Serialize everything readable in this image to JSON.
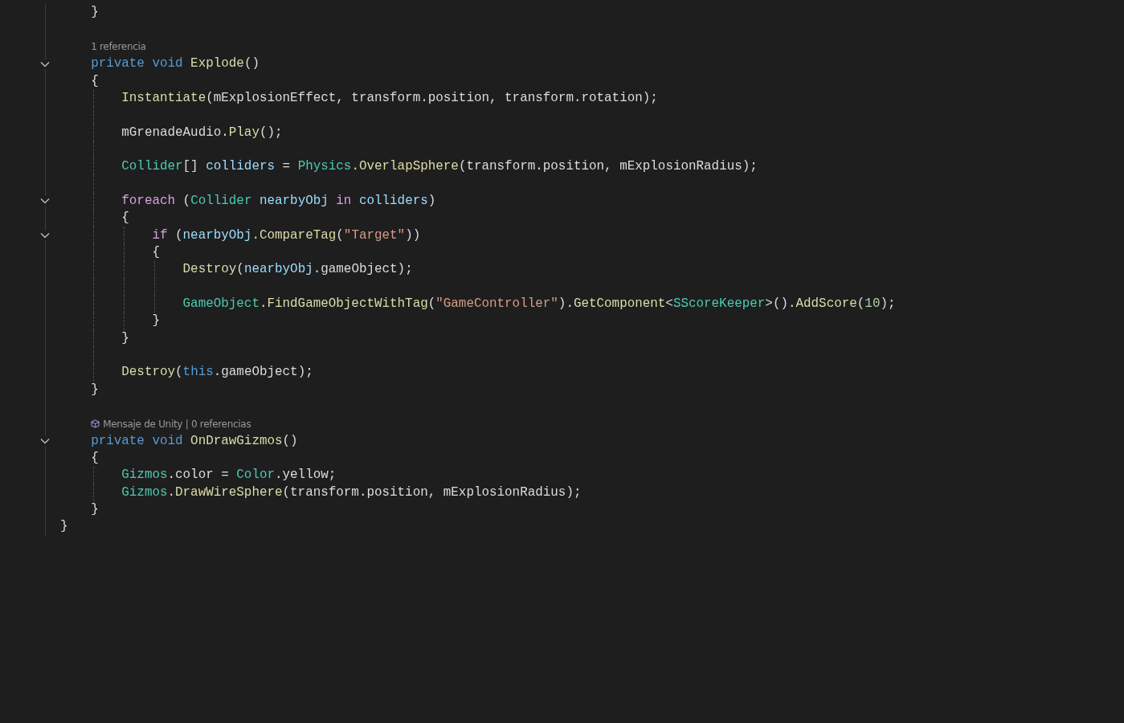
{
  "editor": {
    "lines": [
      {
        "kind": "block",
        "children": [
          {
            "kind": "code",
            "tokens": [
              {
                "text": "}",
                "color": "#dcdcdc"
              }
            ]
          },
          {
            "kind": "blank"
          },
          {
            "kind": "lens",
            "text": "1 referencia"
          },
          {
            "kind": "code",
            "expanded": true,
            "tokens": [
              {
                "text": "private void ",
                "color": "#569cd6"
              },
              {
                "text": "Explode",
                "color": "#dcdcaa"
              },
              {
                "text": "()",
                "color": "#dcdcdc"
              }
            ]
          },
          {
            "kind": "code",
            "tokens": [
              {
                "text": "{",
                "color": "#dcdcdc"
              }
            ],
            "children": [
              {
                "kind": "code",
                "tokens": [
                  {
                    "text": "Instantiate",
                    "color": "#dcdcaa"
                  },
                  {
                    "text": "(mExplosionEffect, transform.position, transform.rotation);",
                    "color": "#dcdcdc"
                  }
                ]
              },
              {
                "kind": "blank"
              },
              {
                "kind": "code",
                "tokens": [
                  {
                    "text": "mGrenadeAudio.",
                    "color": "#dcdcdc"
                  },
                  {
                    "text": "Play",
                    "color": "#dcdcaa"
                  },
                  {
                    "text": "();",
                    "color": "#dcdcdc"
                  }
                ]
              },
              {
                "kind": "blank"
              },
              {
                "kind": "code",
                "tokens": [
                  {
                    "text": "Collider",
                    "color": "#4ec9b0"
                  },
                  {
                    "text": "[] ",
                    "color": "#dcdcdc"
                  },
                  {
                    "text": "colliders",
                    "color": "#9cdcfe"
                  },
                  {
                    "text": " = ",
                    "color": "#dcdcdc"
                  },
                  {
                    "text": "Physics",
                    "color": "#4ec9b0"
                  },
                  {
                    "text": ".OverlapSphere",
                    "color": "#dcdcaa"
                  },
                  {
                    "text": "(transform.position, mExplosionRadius);",
                    "color": "#dcdcdc"
                  }
                ]
              },
              {
                "kind": "blank"
              },
              {
                "kind": "code",
                "expanded": true,
                "tokens": [
                  {
                    "text": "foreach",
                    "color": "#d8a0df"
                  },
                  {
                    "text": " (",
                    "color": "#dcdcdc"
                  },
                  {
                    "text": "Collider",
                    "color": "#4ec9b0"
                  },
                  {
                    "text": " nearbyObj ",
                    "color": "#9cdcfe"
                  },
                  {
                    "text": "in",
                    "color": "#d8a0df"
                  },
                  {
                    "text": " colliders",
                    "color": "#9cdcfe"
                  },
                  {
                    "text": ")",
                    "color": "#dcdcdc"
                  }
                ]
              },
              {
                "kind": "code",
                "tokens": [
                  {
                    "text": "{",
                    "color": "#dcdcdc"
                  }
                ],
                "children": [
                  {
                    "kind": "code",
                    "expanded": true,
                    "tokens": [
                      {
                        "text": "if",
                        "color": "#d8a0df"
                      },
                      {
                        "text": " (",
                        "color": "#dcdcdc"
                      },
                      {
                        "text": "nearbyObj",
                        "color": "#9cdcfe"
                      },
                      {
                        "text": ".CompareTag",
                        "color": "#dcdcaa"
                      },
                      {
                        "text": "(",
                        "color": "#dcdcdc"
                      },
                      {
                        "text": "\"Target\"",
                        "color": "#d69d85"
                      },
                      {
                        "text": "))",
                        "color": "#dcdcdc"
                      }
                    ]
                  },
                  {
                    "kind": "code",
                    "tokens": [
                      {
                        "text": "{",
                        "color": "#dcdcdc"
                      }
                    ],
                    "children": [
                      {
                        "kind": "code",
                        "tokens": [
                          {
                            "text": "Destroy",
                            "color": "#dcdcaa"
                          },
                          {
                            "text": "(",
                            "color": "#dcdcdc"
                          },
                          {
                            "text": "nearbyObj",
                            "color": "#9cdcfe"
                          },
                          {
                            "text": ".gameObject);",
                            "color": "#dcdcdc"
                          }
                        ]
                      },
                      {
                        "kind": "blank"
                      },
                      {
                        "kind": "code",
                        "tokens": [
                          {
                            "text": "GameObject",
                            "color": "#4ec9b0"
                          },
                          {
                            "text": ".FindGameObjectWithTag",
                            "color": "#dcdcaa"
                          },
                          {
                            "text": "(",
                            "color": "#dcdcdc"
                          },
                          {
                            "text": "\"GameController\"",
                            "color": "#d69d85"
                          },
                          {
                            "text": ").",
                            "color": "#dcdcdc"
                          },
                          {
                            "text": "GetComponent",
                            "color": "#dcdcaa"
                          },
                          {
                            "text": "<",
                            "color": "#dcdcdc"
                          },
                          {
                            "text": "SScoreKeeper",
                            "color": "#4ec9b0"
                          },
                          {
                            "text": ">().",
                            "color": "#dcdcdc"
                          },
                          {
                            "text": "AddScore",
                            "color": "#dcdcaa"
                          },
                          {
                            "text": "(",
                            "color": "#dcdcdc"
                          },
                          {
                            "text": "10",
                            "color": "#b5cea8"
                          },
                          {
                            "text": ");",
                            "color": "#dcdcdc"
                          }
                        ]
                      }
                    ]
                  },
                  {
                    "kind": "code",
                    "tokens": [
                      {
                        "text": "}",
                        "color": "#dcdcdc"
                      }
                    ]
                  }
                ]
              },
              {
                "kind": "code",
                "tokens": [
                  {
                    "text": "}",
                    "color": "#dcdcdc"
                  }
                ]
              },
              {
                "kind": "blank"
              },
              {
                "kind": "code",
                "tokens": [
                  {
                    "text": "Destroy",
                    "color": "#dcdcaa"
                  },
                  {
                    "text": "(",
                    "color": "#dcdcdc"
                  },
                  {
                    "text": "this",
                    "color": "#569cd6"
                  },
                  {
                    "text": ".gameObject);",
                    "color": "#dcdcdc"
                  }
                ]
              }
            ]
          },
          {
            "kind": "code",
            "tokens": [
              {
                "text": "}",
                "color": "#dcdcdc"
              }
            ]
          },
          {
            "kind": "blank"
          },
          {
            "kind": "lens_unity",
            "text": "Mensaje de Unity | 0 referencias"
          },
          {
            "kind": "code",
            "expanded": true,
            "tokens": [
              {
                "text": "private void ",
                "color": "#569cd6"
              },
              {
                "text": "OnDrawGizmos",
                "color": "#dcdcaa"
              },
              {
                "text": "()",
                "color": "#dcdcdc"
              }
            ]
          },
          {
            "kind": "code",
            "tokens": [
              {
                "text": "{",
                "color": "#dcdcdc"
              }
            ],
            "children": [
              {
                "kind": "code",
                "tokens": [
                  {
                    "text": "Gizmos",
                    "color": "#4ec9b0"
                  },
                  {
                    "text": ".color = ",
                    "color": "#dcdcdc"
                  },
                  {
                    "text": "Color",
                    "color": "#4ec9b0"
                  },
                  {
                    "text": ".yellow;",
                    "color": "#dcdcdc"
                  }
                ]
              },
              {
                "kind": "code",
                "tokens": [
                  {
                    "text": "Gizmos",
                    "color": "#4ec9b0"
                  },
                  {
                    "text": ".DrawWireSphere",
                    "color": "#dcdcaa"
                  },
                  {
                    "text": "(transform.position, mExplosionRadius);",
                    "color": "#dcdcdc"
                  }
                ]
              }
            ]
          },
          {
            "kind": "code",
            "tokens": [
              {
                "text": "}",
                "color": "#dcdcdc"
              }
            ]
          }
        ]
      },
      {
        "kind": "code",
        "tokens": [
          {
            "text": "}",
            "color": "#dcdcdc"
          }
        ]
      }
    ]
  }
}
